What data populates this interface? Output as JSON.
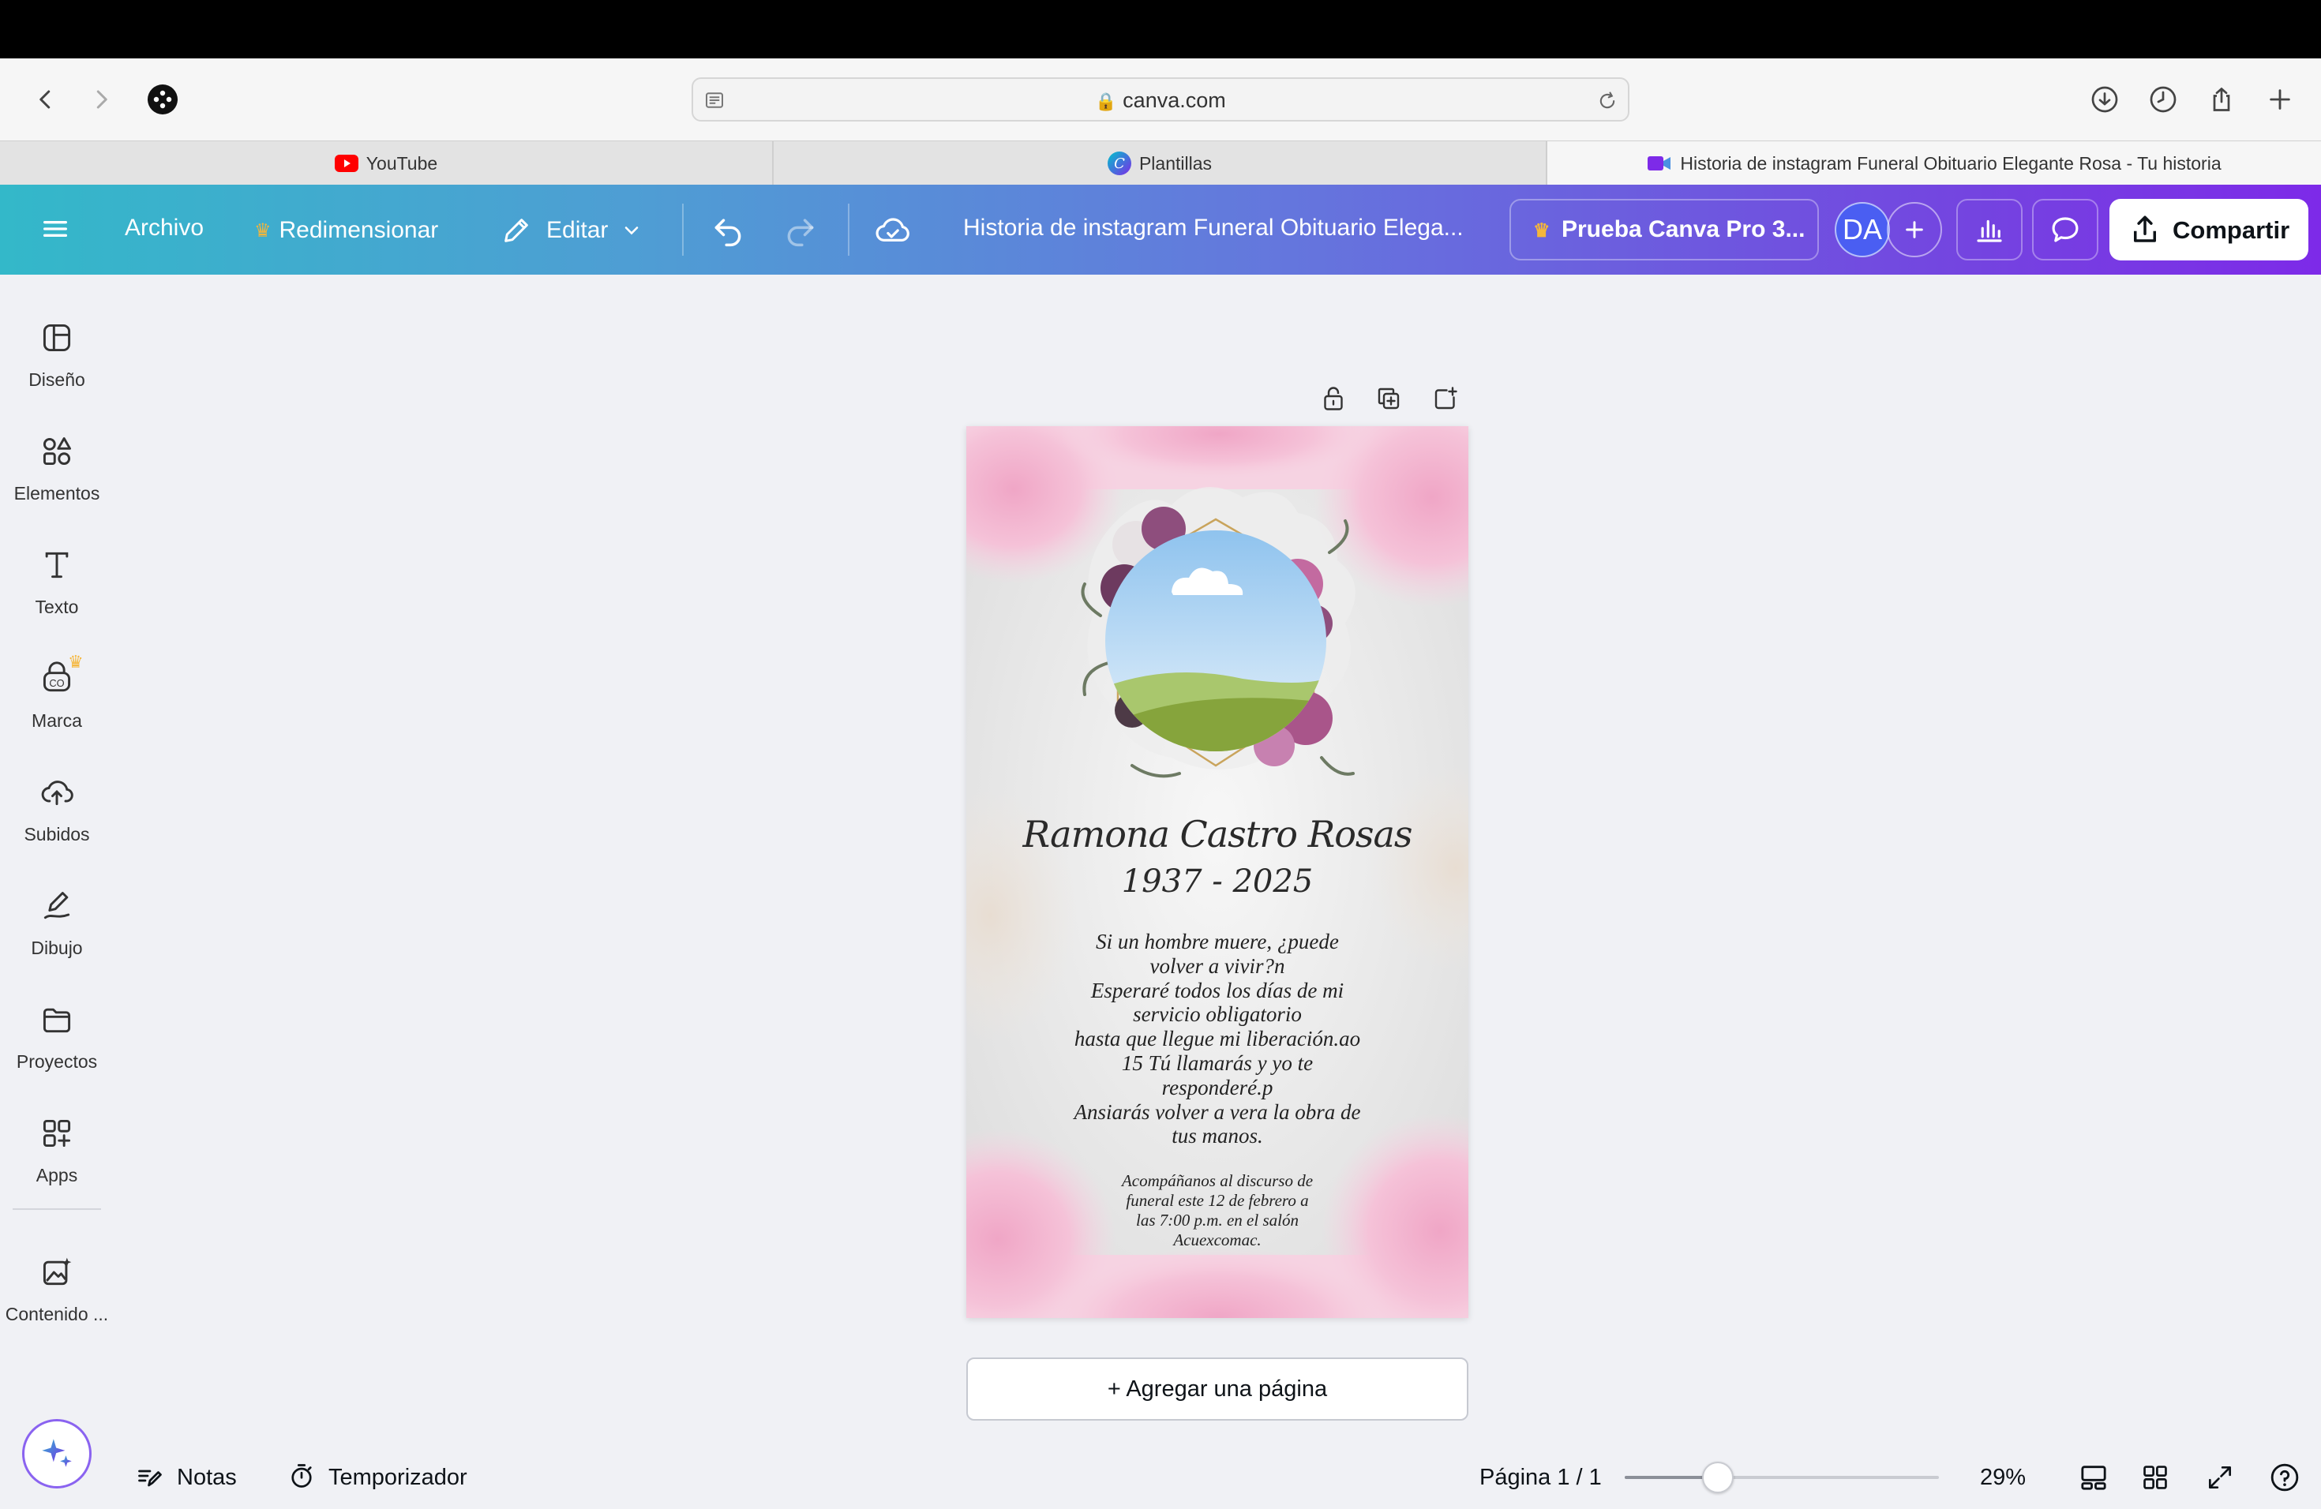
{
  "browser": {
    "url": "canva.com",
    "tabs": [
      {
        "label": "YouTube"
      },
      {
        "label": "Plantillas"
      },
      {
        "label": "Historia de instagram Funeral Obituario Elegante Rosa - Tu historia"
      }
    ]
  },
  "header": {
    "file_label": "Archivo",
    "resize_label": "Redimensionar",
    "edit_label": "Editar",
    "doc_title": "Historia de instagram Funeral Obituario Elega...",
    "pro_label": "Prueba Canva Pro 3...",
    "avatar_initials": "DA",
    "share_label": "Compartir"
  },
  "sidebar": {
    "items": [
      {
        "label": "Diseño",
        "icon": "layout-icon"
      },
      {
        "label": "Elementos",
        "icon": "shapes-icon"
      },
      {
        "label": "Texto",
        "icon": "text-icon"
      },
      {
        "label": "Marca",
        "icon": "brand-icon"
      },
      {
        "label": "Subidos",
        "icon": "upload-cloud-icon"
      },
      {
        "label": "Dibujo",
        "icon": "pen-icon"
      },
      {
        "label": "Proyectos",
        "icon": "folder-icon"
      },
      {
        "label": "Apps",
        "icon": "apps-grid-icon"
      },
      {
        "label": "Contenido ...",
        "icon": "magic-media-icon"
      }
    ]
  },
  "design": {
    "name": "Ramona Castro Rosas",
    "years": "1937 - 2025",
    "poem": "Si un hombre muere, ¿puede\nvolver a vivir?n\nEsperaré todos los días de mi\nservicio obligatorio\nhasta que llegue mi liberación.ao\n15 Tú llamarás y yo te\nresponderé.p\nAnsiarás volver a vera la obra de\ntus manos.",
    "invite": "Acompáñanos al discurso de\nfuneral este 12 de febrero a\nlas 7:00 p.m. en el salón\nAcuexcomac."
  },
  "canvas": {
    "add_page_label": "+  Agregar una página"
  },
  "footer": {
    "notes_label": "Notas",
    "timer_label": "Temporizador",
    "page_indicator": "Página 1 / 1",
    "zoom_level": "29%",
    "zoom_fraction": 0.29
  },
  "colors": {
    "accent_purple": "#7d2ae8",
    "accent_teal": "#33b8c9",
    "pro_crown": "#f5b63a"
  }
}
